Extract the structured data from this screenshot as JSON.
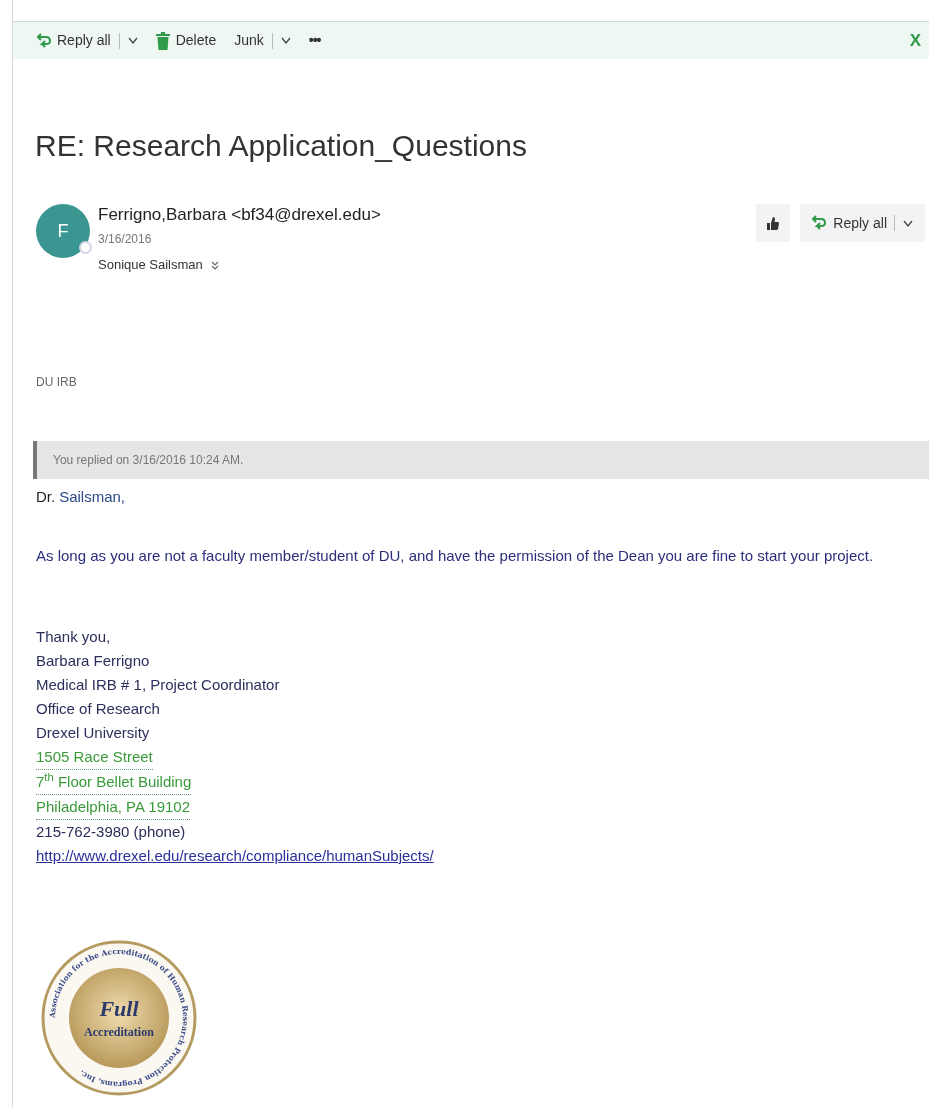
{
  "toolbar": {
    "items": [
      {
        "kind": "reply",
        "label": "Reply all",
        "has_menu": true
      },
      {
        "kind": "delete",
        "label": "Delete",
        "has_menu": false
      },
      {
        "kind": "plain",
        "label": "Junk",
        "has_menu": true
      },
      {
        "kind": "more",
        "label": "•••",
        "has_menu": false
      }
    ],
    "close": "X"
  },
  "subject": "RE: Research Application_Questions",
  "message": {
    "avatar_letter": "F",
    "sender": "Ferrigno,Barbara <bf34@drexel.edu>",
    "date": "3/16/2016",
    "recipient": "Sonique Sailsman",
    "reply_button": "Reply all"
  },
  "preheader": "DU IRB",
  "replied_notice": "You replied on 3/16/2016 10:24 AM.",
  "greeting": {
    "title": "Dr.",
    "name": "Sailsman,"
  },
  "paragraph": "As long as you are not a faculty member/student of DU, and have the permission of the Dean you are fine to start your project.",
  "signature": [
    {
      "kind": "plain",
      "text": "Thank you,"
    },
    {
      "kind": "plain",
      "text": "Barbara Ferrigno"
    },
    {
      "kind": "plain",
      "text": "Medical IRB # 1, Project Coordinator"
    },
    {
      "kind": "plain",
      "text": "Office of Research"
    },
    {
      "kind": "plain",
      "text": "Drexel University"
    },
    {
      "kind": "address",
      "text": "1505 Race Street"
    },
    {
      "kind": "address",
      "text": "7$^{th}$ Floor Bellet Building"
    },
    {
      "kind": "address",
      "text": "Philadelphia, PA 19102"
    },
    {
      "kind": "plain",
      "text": "215-762-3980 (phone)"
    },
    {
      "kind": "link",
      "text": "http://www.drexel.edu/research/compliance/humanSubjects/"
    }
  ],
  "seal": {
    "ring_text": "Association for the Accreditation of Human Research Protection Programs, Inc.",
    "line_1": "Full",
    "line_2": "Accreditation"
  }
}
